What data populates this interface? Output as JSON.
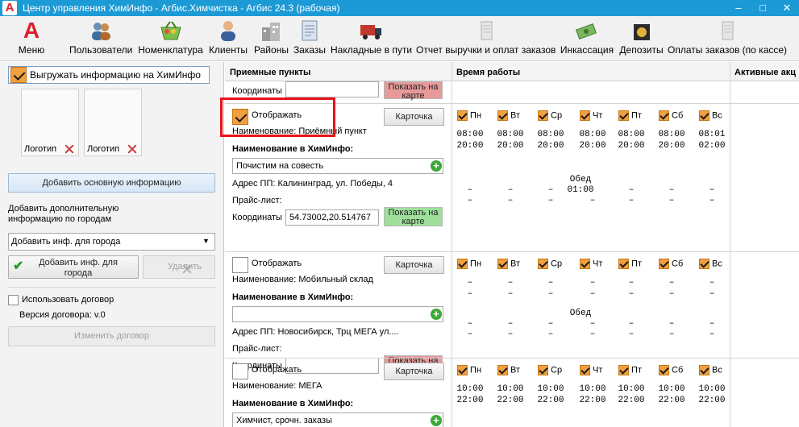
{
  "window": {
    "title": "Центр управления ХимИнфо - Агбис.Химчистка - Агбис 24.3 (рабочая)",
    "logo_letter": "A"
  },
  "toolbar": {
    "items": [
      {
        "label": "Меню",
        "icon": "menu-a-icon"
      },
      {
        "label": "Пользователи",
        "icon": "users-icon"
      },
      {
        "label": "Номенклатура",
        "icon": "basket-icon"
      },
      {
        "label": "Клиенты",
        "icon": "client-icon"
      },
      {
        "label": "Районы",
        "icon": "buildings-icon"
      },
      {
        "label": "Заказы",
        "icon": "orders-icon"
      },
      {
        "label": "Накладные в пути",
        "icon": "truck-icon"
      },
      {
        "label": "Отчет выручки и оплат заказов",
        "icon": "report-icon"
      },
      {
        "label": "Инкассация",
        "icon": "cash-icon"
      },
      {
        "label": "Депозиты",
        "icon": "deposit-icon"
      },
      {
        "label": "Оплаты заказов (по кассе)",
        "icon": "payments-icon"
      }
    ]
  },
  "left": {
    "export_label": "Выгружать информацию на ХимИнфо",
    "export_checked": true,
    "logo1_label": "Логотип",
    "logo2_label": "Логотип",
    "add_main_info": "Добавить основную информацию",
    "add_extra_info": "Добавить дополнительную информацию по городам",
    "city_select": "Добавить инф. для города",
    "add_city_info": "Добавить инф. для города",
    "delete": "Удалить",
    "use_contract": "Использовать договор",
    "contract_version": "Версия договора: v.0",
    "change_contract": "Изменить договор"
  },
  "grid": {
    "headers": {
      "points": "Приемные пункты",
      "hours": "Время работы",
      "active": "Активные акц"
    },
    "top_partial": {
      "coords_label": "Координаты",
      "map_button": "Показать на карте"
    },
    "rows": [
      {
        "display_label": "Отображать",
        "display_checked": true,
        "card_button": "Карточка",
        "name_line": "Наименование: Приёмный пункт",
        "himinfo_label": "Наименование в ХимИнфо:",
        "himinfo_value": "Почистим на совесть",
        "address": "Адрес ПП: Калининград, ул. Победы, 4",
        "price_label": "Прайс-лист:",
        "coords_label": "Координаты",
        "coords_value": "54.73002,20.514767",
        "map_button": "Показать на карте",
        "map_color": "green",
        "days": [
          "Пн",
          "Вт",
          "Ср",
          "Чт",
          "Пт",
          "Сб",
          "Вс"
        ],
        "start": [
          "08:00",
          "08:00",
          "08:00",
          "08:00",
          "08:00",
          "08:00",
          "08:01"
        ],
        "end": [
          "20:00",
          "20:00",
          "20:00",
          "20:00",
          "20:00",
          "20:00",
          "02:00"
        ],
        "lunch_label": "Обед",
        "lunch_time": "01:00",
        "lunch_marks": [
          "–",
          "–",
          "–",
          "",
          "–",
          "–",
          "–"
        ],
        "lunch_marks2": [
          "–",
          "–",
          "–",
          "–",
          "–",
          "–",
          "–"
        ]
      },
      {
        "display_label": "Отображать",
        "display_checked": false,
        "card_button": "Карточка",
        "name_line": "Наименование: Мобильный склад",
        "himinfo_label": "Наименование в ХимИнфо:",
        "himinfo_value": "",
        "address": "Адрес ПП: Новосибирск, Трц МЕГА ул....",
        "price_label": "Прайс-лист:",
        "coords_label": "Координаты",
        "coords_value": "",
        "map_button": "Показать на карте",
        "map_color": "red",
        "days": [
          "Пн",
          "Вт",
          "Ср",
          "Чт",
          "Пт",
          "Сб",
          "Вс"
        ],
        "lunch_label": "Обед",
        "dash": "–"
      },
      {
        "display_label": "Отображать",
        "display_checked": false,
        "card_button": "Карточка",
        "name_line": "Наименование: МЕГА",
        "himinfo_label": "Наименование в ХимИнфо:",
        "himinfo_value": "Химчист, срочн. заказы",
        "days": [
          "Пн",
          "Вт",
          "Ср",
          "Чт",
          "Пт",
          "Сб",
          "Вс"
        ],
        "start": [
          "10:00",
          "10:00",
          "10:00",
          "10:00",
          "10:00",
          "10:00",
          "10:00"
        ],
        "end": [
          "22:00",
          "22:00",
          "22:00",
          "22:00",
          "22:00",
          "22:00",
          "22:00"
        ]
      }
    ]
  },
  "colors": {
    "titlebar": "#1c9ad6",
    "highlight": "#e8141b",
    "check": "#f0a040"
  }
}
